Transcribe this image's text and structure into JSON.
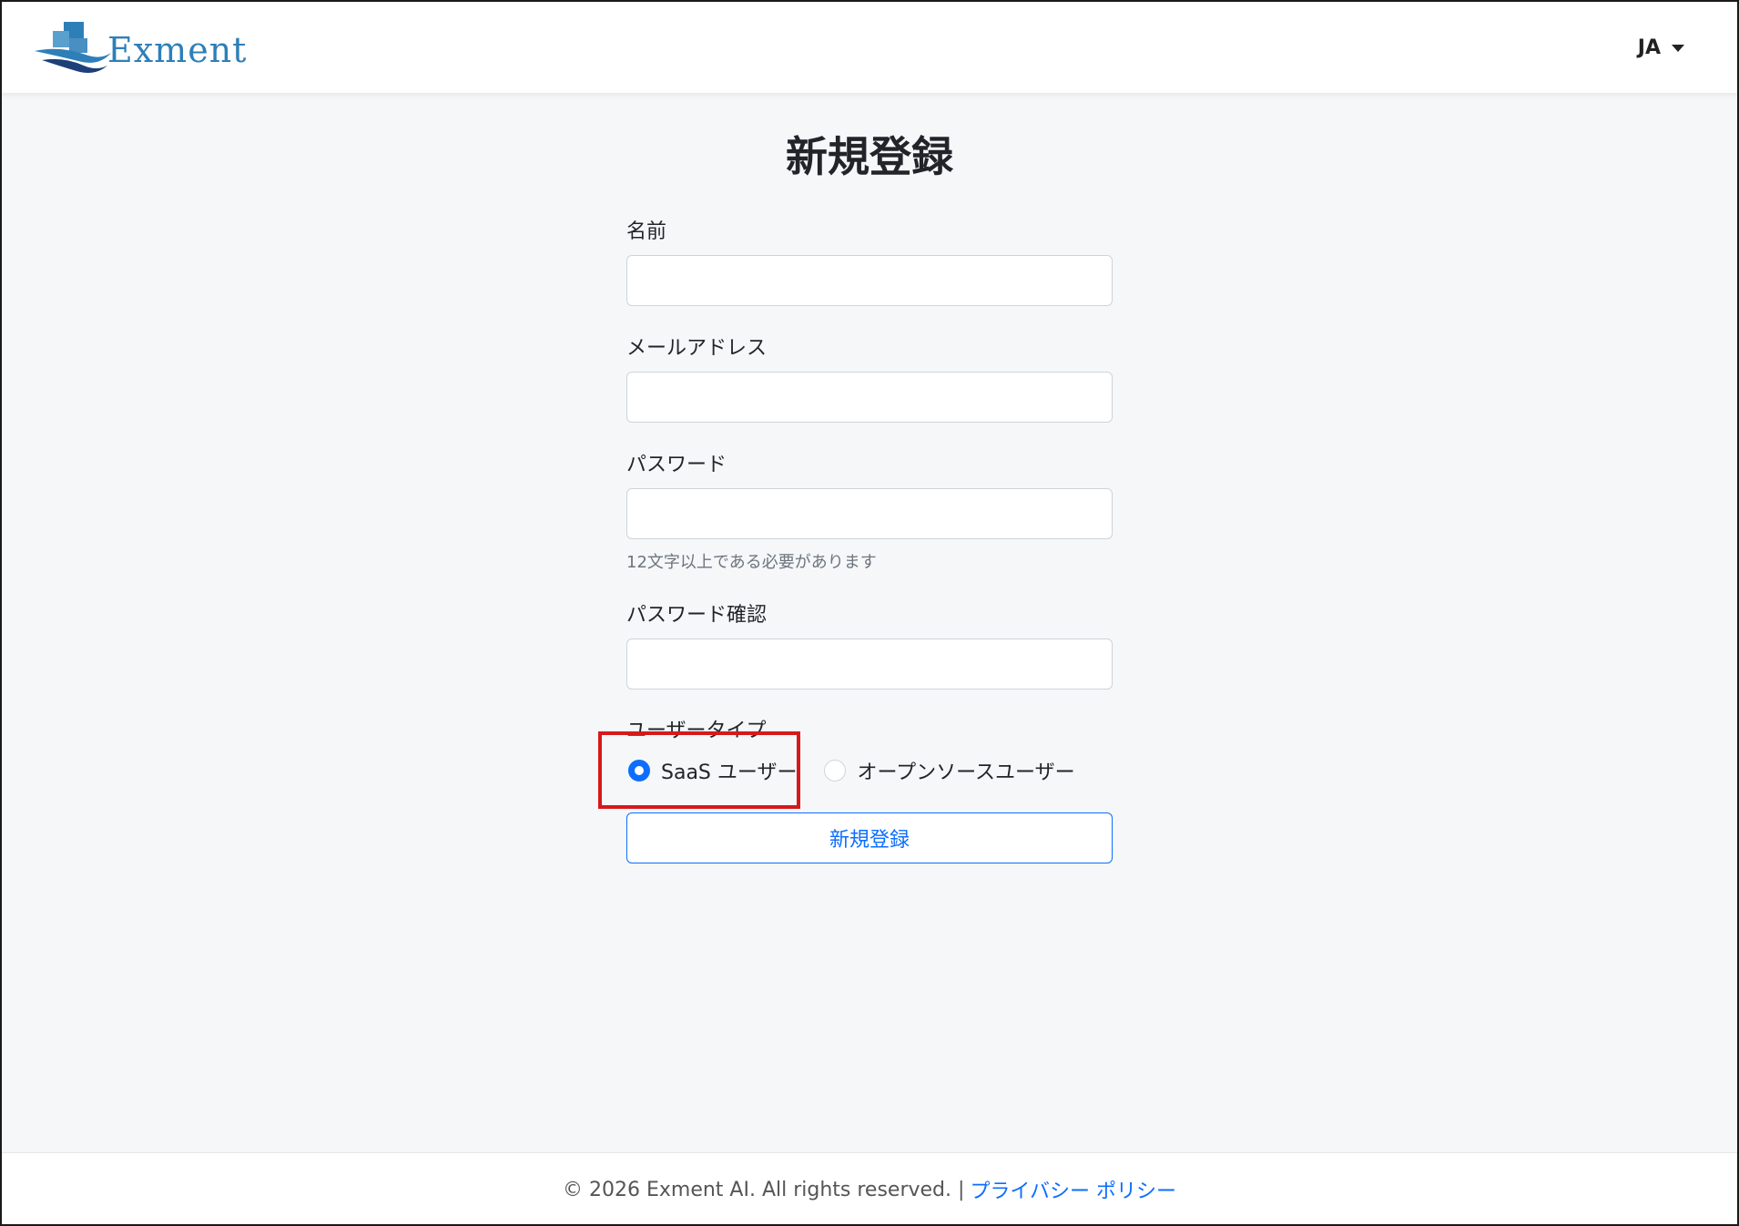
{
  "header": {
    "logo_text": "Exment",
    "language": "JA"
  },
  "page": {
    "title": "新規登録"
  },
  "form": {
    "name_label": "名前",
    "name_value": "",
    "email_label": "メールアドレス",
    "email_value": "",
    "password_label": "パスワード",
    "password_value": "",
    "password_hint": "12文字以上である必要があります",
    "password_confirm_label": "パスワード確認",
    "password_confirm_value": "",
    "user_type_label": "ユーザータイプ",
    "user_type_options": [
      {
        "label": "SaaS ユーザー",
        "selected": true
      },
      {
        "label": "オープンソースユーザー",
        "selected": false
      }
    ],
    "submit_label": "新規登録"
  },
  "footer": {
    "copyright": "© 2026 Exment AI. All rights reserved. |",
    "privacy_link": "プライバシー ポリシー"
  },
  "colors": {
    "accent": "#0d6efd",
    "brand": "#2e7fb8",
    "highlight": "#d7191c"
  }
}
